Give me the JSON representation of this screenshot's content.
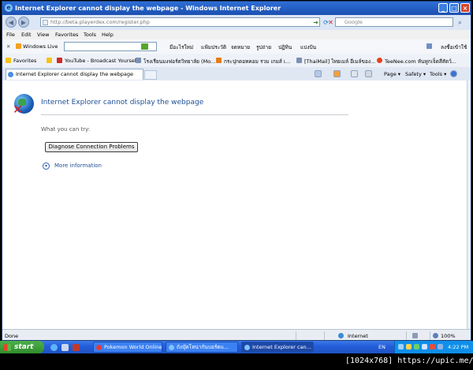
{
  "window": {
    "title": "Internet Explorer cannot display the webpage - Windows Internet Explorer",
    "min": "_",
    "max": "□",
    "close": "×"
  },
  "address": {
    "url": "http://beta.playerdex.com/register.php",
    "search_placeholder": "Google"
  },
  "menu": [
    "File",
    "Edit",
    "View",
    "Favorites",
    "Tools",
    "Help"
  ],
  "live_toolbar": {
    "brand": "Windows Live",
    "links": [
      "มีอะไรใหม่",
      "แฟ้มประวัติ",
      "จดหมาย",
      "รูปถ่าย",
      "ปฏิทิน",
      "แบ่งปัน"
    ],
    "signin": "ลงชื่อเข้าใช้"
  },
  "favorites_bar": {
    "label": "Favorites",
    "items": [
      "YouTube - Broadcast Yourself",
      "โรงเรียนมงฟอร์ตวิทยาลัย (Mo...",
      "กระปุกดอทคอม รวม เกมส์ เ...",
      "[ThaiMail] ไทยเมล์ อีเมล์ของ...",
      "TeeNee.com หันหูกเจ็ดสีสัตว์..."
    ]
  },
  "tab": {
    "label": "Internet Explorer cannot display the webpage"
  },
  "command_bar": {
    "page": "Page ▾",
    "safety": "Safety ▾",
    "tools": "Tools ▾"
  },
  "error_page": {
    "title": "Internet Explorer cannot display the webpage",
    "what_you_can_try": "What you can try:",
    "diagnose_button": "Diagnose Connection Problems",
    "more_information": "More information"
  },
  "status_bar": {
    "status": "Done",
    "zone": "Internet",
    "zoom": "100%"
  },
  "taskbar": {
    "start": "start",
    "tasks": [
      "Pokemon World Online",
      "ถังบุ๊คโหน่ากันบอร์ดแ...",
      "Internet Explorer can..."
    ],
    "language": "EN",
    "clock": "4:22 PM"
  },
  "caption": "[1024x768] https://upic.me/",
  "colors": {
    "titlebar": "#1b4fb0",
    "link": "#1f4e96",
    "taskbar": "#245edb",
    "start": "#3a9a36"
  }
}
